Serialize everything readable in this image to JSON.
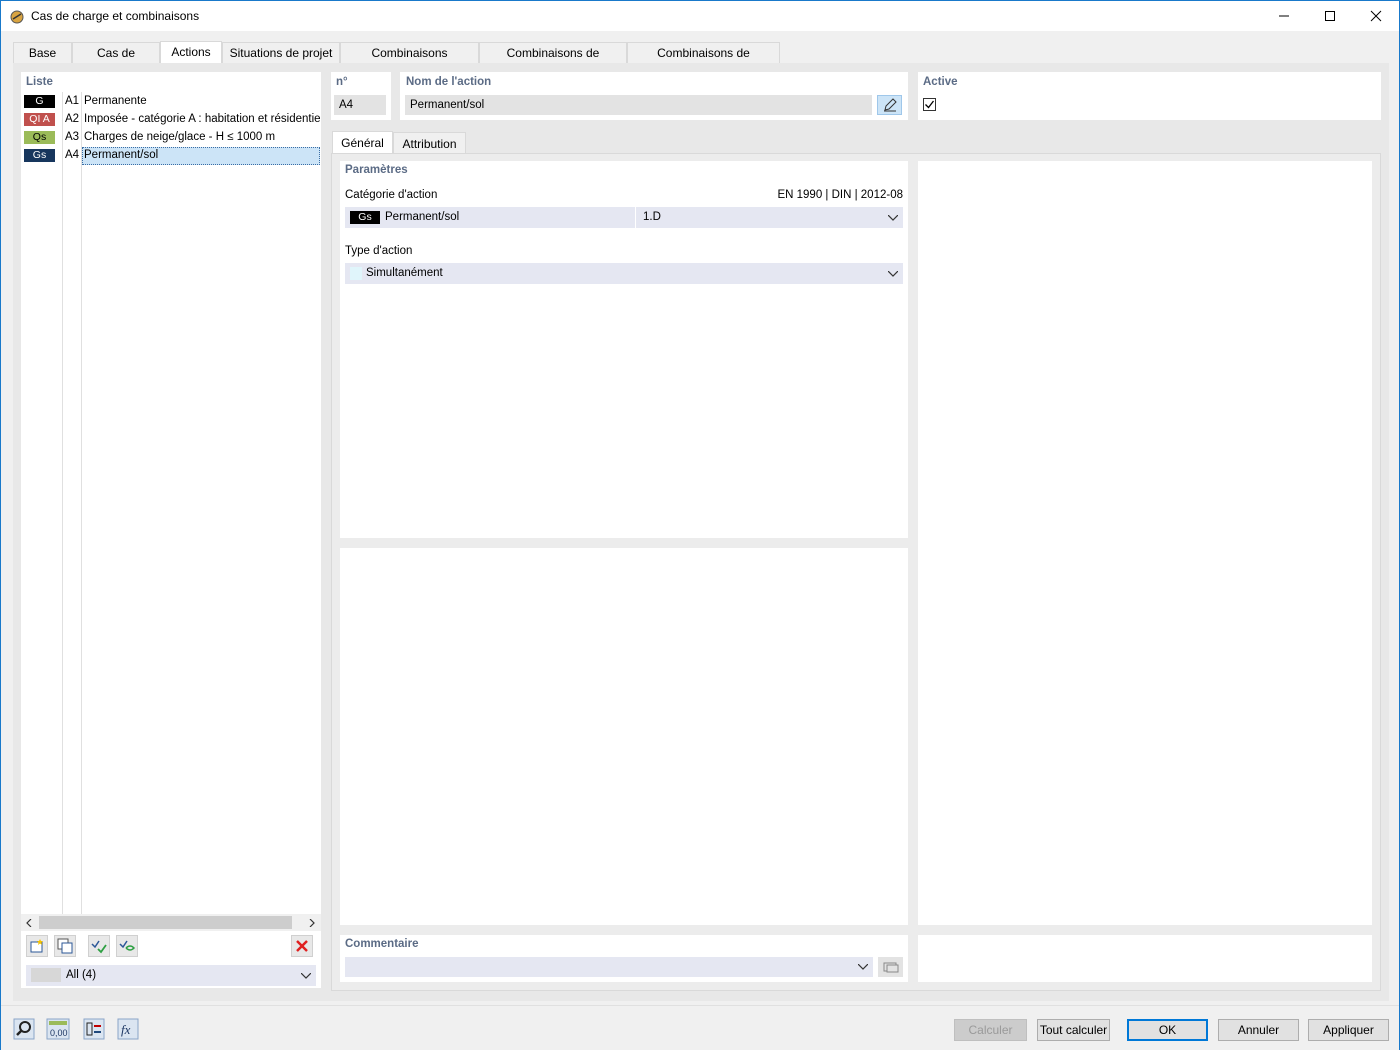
{
  "window": {
    "title": "Cas de charge et combinaisons"
  },
  "main_tabs": [
    {
      "label": "Base"
    },
    {
      "label": "Cas de charge"
    },
    {
      "label": "Actions"
    },
    {
      "label": "Situations de projet"
    },
    {
      "label": "Combinaisons d'actions"
    },
    {
      "label": "Combinaisons de charges"
    },
    {
      "label": "Combinaisons de résultats"
    }
  ],
  "list": {
    "title": "Liste",
    "items": [
      {
        "badge": "G",
        "badge_bg": "#000000",
        "badge_fg": "#ffffff",
        "num": "A1",
        "name": "Permanente"
      },
      {
        "badge": "QI A",
        "badge_bg": "#c0504d",
        "badge_fg": "#ffffff",
        "num": "A2",
        "name": "Imposée - catégorie A : habitation et résidentielle"
      },
      {
        "badge": "Qs",
        "badge_bg": "#9bbb59",
        "badge_fg": "#000000",
        "num": "A3",
        "name": "Charges de neige/glace - H ≤ 1000 m"
      },
      {
        "badge": "Gs",
        "badge_bg": "#17365d",
        "badge_fg": "#ffffff",
        "num": "A4",
        "name": "Permanent/sol"
      }
    ],
    "filter": "All (4)"
  },
  "header": {
    "no_label": "n°",
    "no_value": "A4",
    "name_label": "Nom de l'action",
    "name_value": "Permanent/sol",
    "active_label": "Active",
    "active_checked": true
  },
  "sub_tabs": [
    {
      "label": "Général"
    },
    {
      "label": "Attribution"
    }
  ],
  "params": {
    "title": "Paramètres",
    "category_label": "Catégorie d'action",
    "norm": "EN 1990 | DIN | 2012-08",
    "category_badge": "Gs",
    "category_name": "Permanent/sol",
    "category_code": "1.D",
    "type_label": "Type d'action",
    "type_value": "Simultanément"
  },
  "comment": {
    "title": "Commentaire",
    "value": ""
  },
  "buttons": {
    "calc": "Calculer",
    "calc_all": "Tout calculer",
    "ok": "OK",
    "cancel": "Annuler",
    "apply": "Appliquer"
  },
  "colors": {
    "accent": "#0078d7",
    "section_title": "#5b6b85",
    "selection": "#cce4f7"
  }
}
